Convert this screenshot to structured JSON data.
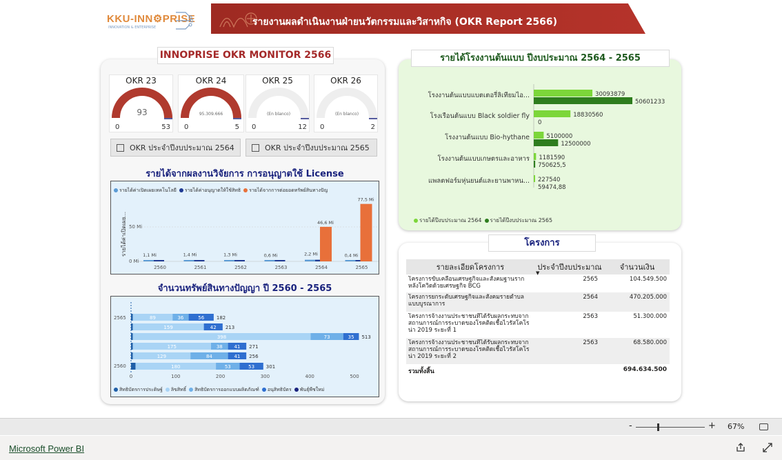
{
  "header": {
    "logo_text": "KKU-INN⚙PRISE",
    "logo_sub": "INNOVATION & ENTERPRISE",
    "title": "รายงานผลดำเนินงานฝ่ายนวัตกรรมและวิสาหกิจ (OKR Report 2566)"
  },
  "okr_panel": {
    "title": "INNOPRISE OKR MONITOR 2566",
    "gauges": [
      {
        "label": "OKR 23",
        "value": "93",
        "min": "0",
        "max": "53",
        "fill": 1.0,
        "color": "#b03a2e",
        "empty": false
      },
      {
        "label": "OKR 24",
        "value": "95.309.666",
        "min": "0",
        "max": "5",
        "fill": 1.0,
        "color": "#b03a2e",
        "empty": false
      },
      {
        "label": "OKR 25",
        "value": "(En blanco)",
        "min": "0",
        "max": "12",
        "fill": 0,
        "color": "#b03a2e",
        "empty": true
      },
      {
        "label": "OKR 26",
        "value": "(En blanco)",
        "min": "0",
        "max": "2",
        "fill": 0,
        "color": "#b03a2e",
        "empty": true
      }
    ],
    "buttons": [
      "OKR ประจำปีงบประมาณ 2564",
      "OKR ประจำปีงบประมาณ 2565"
    ]
  },
  "license_chart": {
    "title": "รายได้จากผลงานวิจัยการ การอนุญาตใช้ License",
    "legend": [
      {
        "name": "รายได้ค่าเปิดเผยเทคโนโลยี",
        "color": "#5b9bd5"
      },
      {
        "name": "รายได้ค่าอนุญาตให้ใช้สิทธิ",
        "color": "#1f3a93"
      },
      {
        "name": "รายได้จากการต่อยอดทรัพย์สินทางปัญ",
        "color": "#e8703a"
      }
    ],
    "ylabel": "รายได้ค่าเปิดเผย...",
    "yticks": [
      "0 Mi",
      "50 Mi"
    ]
  },
  "ip_chart": {
    "title": "จำนวนทรัพย์สินทางปัญญา ปี 2560 - 2565",
    "ylabels": [
      "2565",
      "2560"
    ],
    "xticks": [
      "0",
      "100",
      "200",
      "300",
      "400",
      "500"
    ],
    "legend": [
      {
        "name": "สิทธิบัตรการประดิษฐ์",
        "color": "#1f5fa8"
      },
      {
        "name": "ลิขสิทธิ์",
        "color": "#a9d4f5"
      },
      {
        "name": "สิทธิบัตรการออกแบบผลิตภัณฑ์",
        "color": "#6fb0e8"
      },
      {
        "name": "อนุสิทธิบัตร",
        "color": "#2f6fd0"
      },
      {
        "name": "พันธุ์พืชใหม่",
        "color": "#1a237e"
      }
    ]
  },
  "prototype_chart": {
    "title": "รายได้โรงงานต้นแบบ ปีงบประมาณ 2564 - 2565",
    "legend": [
      {
        "name": "รายได้ปีงบประมาณ 2564",
        "color": "#7cd63a"
      },
      {
        "name": "รายได้ปีงบประมาณ 2565",
        "color": "#2e7d1e"
      }
    ]
  },
  "projects": {
    "title": "โครงการ",
    "columns": [
      "รายละเอียดโครงการ",
      "ประจำปีงบประมาณ",
      "จำนวนเงิน"
    ],
    "rows": [
      {
        "name": "โครงการขับเคลื่อนเศรษฐกิจและสังคมฐานรากหลังโควิดด้วยเศรษฐกิจ BCG",
        "year": "2565",
        "amount": "104.549.500"
      },
      {
        "name": "โครงการยกระดับเศรษฐกิจและสังคมรายตำบลแบบบูรณาการ",
        "year": "2564",
        "amount": "470.205.000"
      },
      {
        "name": "โครงการจ้างงานประชาชนที่ได้รับผลกระทบจากสถานการณ์การระบาดของโรคติดเชื้อไวรัสโคโรน่า 2019 ระยะที่ 1",
        "year": "2563",
        "amount": "51.300.000"
      },
      {
        "name": "โครงการจ้างงานประชาชนที่ได้รับผลกระทบจากสถานการณ์การระบาดของโรคติดเชื้อไวรัสโคโรน่า 2019 ระยะที่ 2",
        "year": "2563",
        "amount": "68.580.000"
      }
    ],
    "total_label": "รวมทั้งสิ้น",
    "total_amount": "694.634.500"
  },
  "zoom": {
    "minus": "-",
    "plus": "+",
    "level": "67%"
  },
  "footer": {
    "brand": "Microsoft Power BI"
  },
  "chart_data": [
    {
      "type": "bar",
      "title": "รายได้จากผลงานวิจัยการ การอนุญาตใช้ License",
      "categories": [
        "2560",
        "2561",
        "2562",
        "2563",
        "2564",
        "2565"
      ],
      "series": [
        {
          "name": "รายได้ค่าเปิดเผยเทคโนโลยี",
          "values": [
            1.1,
            1.4,
            1.3,
            0.6,
            2.2,
            0.4
          ],
          "labels": [
            "1,1 Mi",
            "1,4 Mi",
            "1,3 Mi",
            "0,6 Mi",
            "2,2 Mi",
            "0,4 Mi"
          ]
        },
        {
          "name": "รายได้ค่าอนุญาตให้ใช้สิทธิ",
          "values": [
            1.1,
            1.4,
            1.3,
            0.6,
            2.2,
            0.4
          ]
        },
        {
          "name": "รายได้จากการต่อยอดทรัพย์สินทางปัญ",
          "values": [
            0,
            0,
            0,
            0,
            46.6,
            77.5
          ],
          "labels": [
            "",
            "",
            "",
            "",
            "46,6 Mi",
            "77,5 Mi"
          ]
        }
      ],
      "ylim": [
        0,
        80
      ]
    },
    {
      "type": "bar",
      "orientation": "horizontal-stacked",
      "title": "จำนวนทรัพย์สินทางปัญญา ปี 2560 - 2565",
      "rows": [
        {
          "segments": [
            {
              "series": "สิทธิบัตรการประดิษฐ์",
              "value": 4
            },
            {
              "series": "ลิขสิทธิ์",
              "value": 89,
              "label": "89"
            },
            {
              "series": "สิทธิบัตรการออกแบบผลิตภัณฑ์",
              "value": 36,
              "label": "36"
            },
            {
              "series": "อนุสิทธิบัตร",
              "value": 56,
              "label": "56"
            }
          ],
          "total": "182"
        },
        {
          "segments": [
            {
              "series": "สิทธิบัตรการประดิษฐ์",
              "value": 4
            },
            {
              "series": "ลิขสิทธิ์",
              "value": 159,
              "label": "159"
            },
            {
              "series": "อนุสิทธิบัตร",
              "value": 42,
              "label": "42"
            }
          ],
          "total": "213"
        },
        {
          "segments": [
            {
              "series": "สิทธิบัตรการประดิษฐ์",
              "value": 4
            },
            {
              "series": "ลิขสิทธิ์",
              "value": 398,
              "label": "398"
            },
            {
              "series": "สิทธิบัตรการออกแบบผลิตภัณฑ์",
              "value": 73,
              "label": "73"
            },
            {
              "series": "อนุสิทธิบัตร",
              "value": 35,
              "label": "35"
            }
          ],
          "total": "513"
        },
        {
          "segments": [
            {
              "series": "สิทธิบัตรการประดิษฐ์",
              "value": 4
            },
            {
              "series": "ลิขสิทธิ์",
              "value": 175,
              "label": "175"
            },
            {
              "series": "สิทธิบัตรการออกแบบผลิตภัณฑ์",
              "value": 38,
              "label": "38"
            },
            {
              "series": "อนุสิทธิบัตร",
              "value": 41,
              "label": "41"
            }
          ],
          "total": "271"
        },
        {
          "segments": [
            {
              "series": "สิทธิบัตรการประดิษฐ์",
              "value": 4
            },
            {
              "series": "ลิขสิทธิ์",
              "value": 129,
              "label": "129"
            },
            {
              "series": "สิทธิบัตรการออกแบบผลิตภัณฑ์",
              "value": 84,
              "label": "84"
            },
            {
              "series": "อนุสิทธิบัตร",
              "value": 41,
              "label": "41"
            }
          ],
          "total": "256"
        },
        {
          "segments": [
            {
              "series": "สิทธิบัตรการประดิษฐ์",
              "value": 10
            },
            {
              "series": "ลิขสิทธิ์",
              "value": 180,
              "label": "180"
            },
            {
              "series": "สิทธิบัตรการออกแบบผลิตภัณฑ์",
              "value": 53,
              "label": "53"
            },
            {
              "series": "อนุสิทธิบัตร",
              "value": 53,
              "label": "53"
            }
          ],
          "total": "301"
        }
      ],
      "xlim": [
        0,
        500
      ]
    },
    {
      "type": "bar",
      "orientation": "horizontal",
      "title": "รายได้โรงงานต้นแบบ ปีงบประมาณ 2564 - 2565",
      "categories": [
        "โรงงานต้นแบบแบตเตอรี่ลิเทียมไอ...",
        "โรงเรือนต้นแบบ Black soldier fly",
        "โรงงานต้นแบบ Bio-hythane",
        "โรงงานต้นแบบเกษตรและอาหาร",
        "แพลตฟอร์มหุ่นยนต์และยานพาหน..."
      ],
      "series": [
        {
          "name": "รายได้ปีงบประมาณ 2564",
          "values": [
            30093879,
            18830560,
            5100000,
            1181590,
            227540
          ],
          "labels": [
            "30093879",
            "18830560",
            "5100000",
            "1181590",
            "227540"
          ]
        },
        {
          "name": "รายได้ปีงบประมาณ 2565",
          "values": [
            50601233,
            0,
            12500000,
            750625.5,
            59474.88
          ],
          "labels": [
            "50601233",
            "0",
            "12500000",
            "750625,5",
            "59474,88"
          ]
        }
      ]
    }
  ]
}
